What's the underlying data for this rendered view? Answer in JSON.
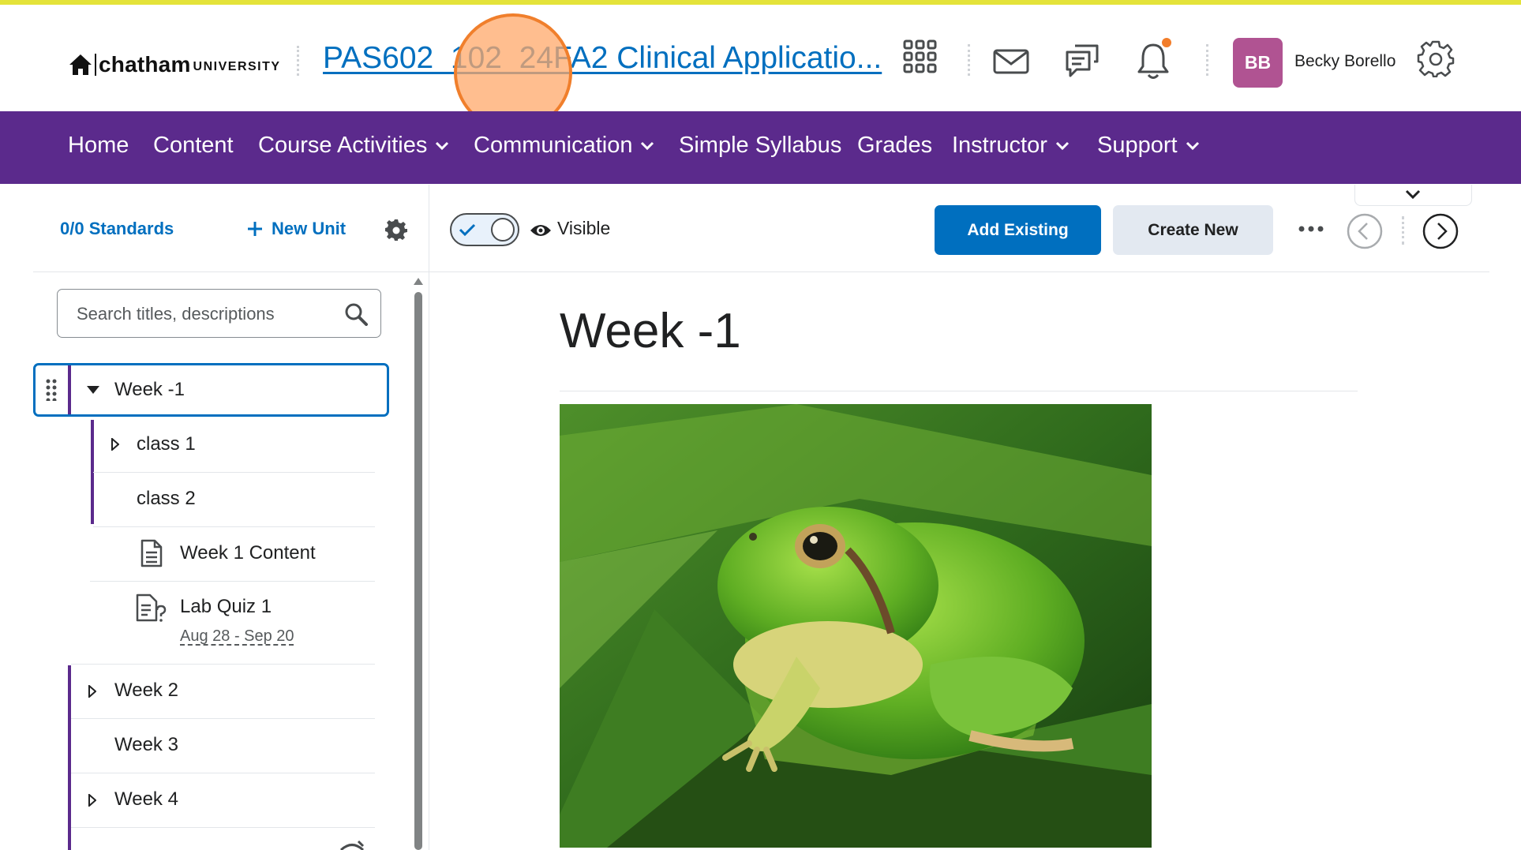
{
  "header": {
    "logo_word": "chatham",
    "logo_sub": "UNIVERSITY",
    "course_title": "PAS602_102_24FA2 Clinical Applicatio...",
    "user_initials": "BB",
    "user_name": "Becky Borello",
    "icons": [
      "waffle-icon",
      "mail-icon",
      "chat-icon",
      "bell-icon",
      "gear-icon"
    ],
    "accent_color": "#e4e33a"
  },
  "nav": {
    "background": "#5b2a8c",
    "items": [
      {
        "label": "Home"
      },
      {
        "label": "Content"
      },
      {
        "label": "Course Activities"
      },
      {
        "label": "Communication"
      },
      {
        "label": "Simple Syllabus"
      },
      {
        "label": "Grades"
      },
      {
        "label": "Instructor"
      },
      {
        "label": "Support"
      }
    ]
  },
  "sidebar": {
    "standards": "0/0 Standards",
    "new_unit": "New Unit",
    "search_placeholder": "Search titles, descriptions",
    "tree": [
      {
        "label": "Week -1"
      },
      {
        "label": "class 1"
      },
      {
        "label": "class 2"
      },
      {
        "label": "Week 1 Content"
      },
      {
        "label": "Lab Quiz 1",
        "dates": "Aug 28 - Sep 20"
      },
      {
        "label": "Week 2"
      },
      {
        "label": "Week 3"
      },
      {
        "label": "Week 4"
      }
    ]
  },
  "toolbar": {
    "visibility_label": "Visible",
    "add_existing": "Add Existing",
    "create_new": "Create New"
  },
  "main": {
    "title": "Week -1"
  }
}
